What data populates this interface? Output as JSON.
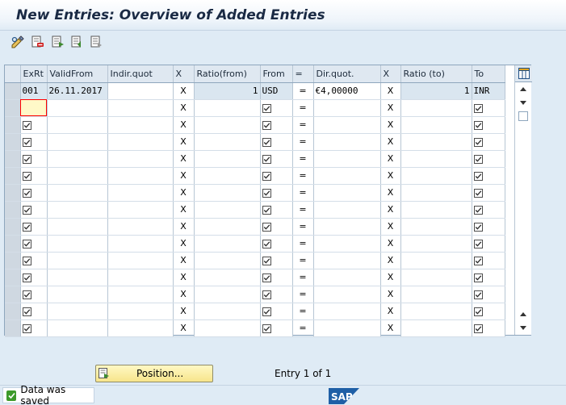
{
  "window": {
    "title": "New Entries: Overview of Added Entries"
  },
  "toolbar": {
    "buttons": [
      {
        "name": "change-display-icon"
      },
      {
        "name": "delete-row-icon"
      },
      {
        "name": "select-all-icon"
      },
      {
        "name": "select-block-icon"
      },
      {
        "name": "deselect-all-icon"
      }
    ]
  },
  "table": {
    "columns": [
      "ExRt",
      "ValidFrom",
      "Indir.quot",
      "X",
      "Ratio(from)",
      "From",
      "=",
      "Dir.quot.",
      "X",
      "Ratio (to)",
      "To"
    ],
    "first_row": {
      "exrt": "001",
      "valid_from": "26.11.2017",
      "indir_quot": "",
      "x1": "X",
      "ratio_from": "1",
      "from": "USD",
      "eq": "=",
      "dir_quot": "€4,00000",
      "x2": "X",
      "ratio_to": "1",
      "to": "INR"
    },
    "empty_row_x": "X",
    "empty_row_eq": "=",
    "empty_row_count": 14
  },
  "footer": {
    "position_button": "Position...",
    "entry_info": "Entry 1 of 1"
  },
  "status": {
    "message": "Data was saved",
    "logo": "SAP"
  },
  "colors": {
    "background": "#dfebf5",
    "header": "#dfe8f1",
    "readonly_cell": "#dae6f0",
    "button_yellow": "#f7e58b",
    "status_ok": "#3d9a2a",
    "sap_blue": "#1f5fa6"
  }
}
